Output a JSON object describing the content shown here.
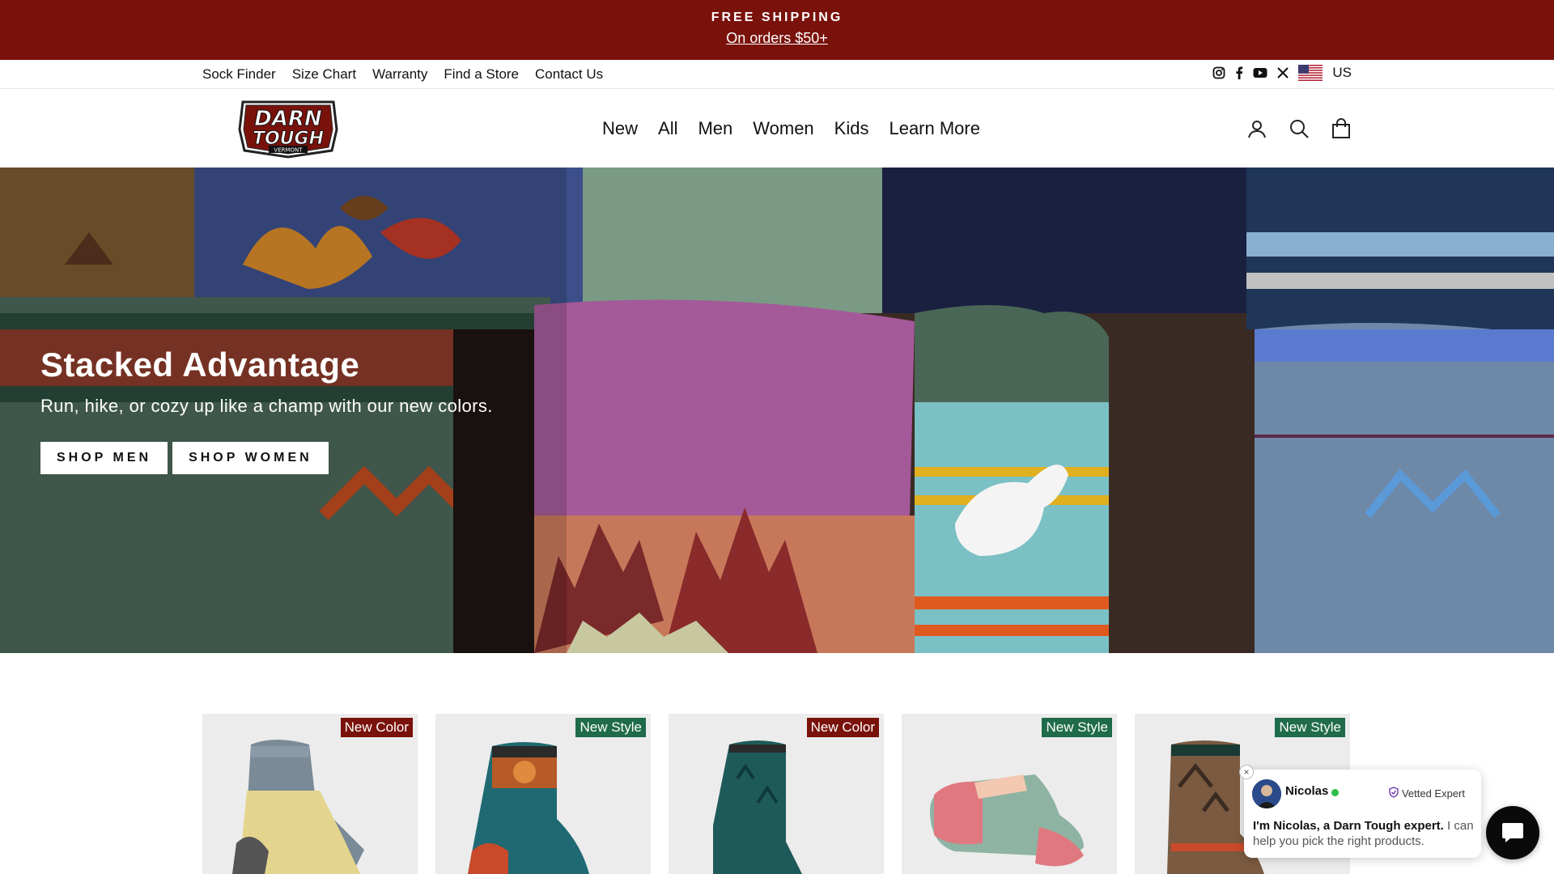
{
  "announcement": {
    "title": "FREE SHIPPING",
    "subtitle": "On orders $50+"
  },
  "utility_links": [
    "Sock Finder",
    "Size Chart",
    "Warranty",
    "Find a Store",
    "Contact Us"
  ],
  "social_icons": [
    "instagram-icon",
    "facebook-icon",
    "youtube-icon",
    "x-icon"
  ],
  "region": {
    "label": "US",
    "flag": "us-flag-icon"
  },
  "logo": {
    "line1": "DARN",
    "line2": "TOUGH",
    "line3": "VERMONT"
  },
  "nav": [
    "New",
    "All",
    "Men",
    "Women",
    "Kids",
    "Learn More"
  ],
  "header_icons": [
    "account-icon",
    "search-icon",
    "cart-icon"
  ],
  "hero": {
    "title": "Stacked Advantage",
    "subtitle": "Run, hike, or cozy up like a champ with our new colors.",
    "buttons": [
      "SHOP MEN",
      "SHOP WOMEN"
    ]
  },
  "products": [
    {
      "badge": "New Color",
      "badge_type": "color"
    },
    {
      "badge": "New Style",
      "badge_type": "style"
    },
    {
      "badge": "New Color",
      "badge_type": "color"
    },
    {
      "badge": "New Style",
      "badge_type": "style"
    },
    {
      "badge": "New Style",
      "badge_type": "style"
    }
  ],
  "chat": {
    "name": "Nicolas",
    "vetted_label": "Vetted Expert",
    "message_bold": "I'm Nicolas, a Darn Tough expert.",
    "message_rest": " I can help you pick the right products.",
    "close": "×"
  },
  "colors": {
    "brand_red": "#7a120c",
    "badge_green": "#1f6b4a"
  }
}
